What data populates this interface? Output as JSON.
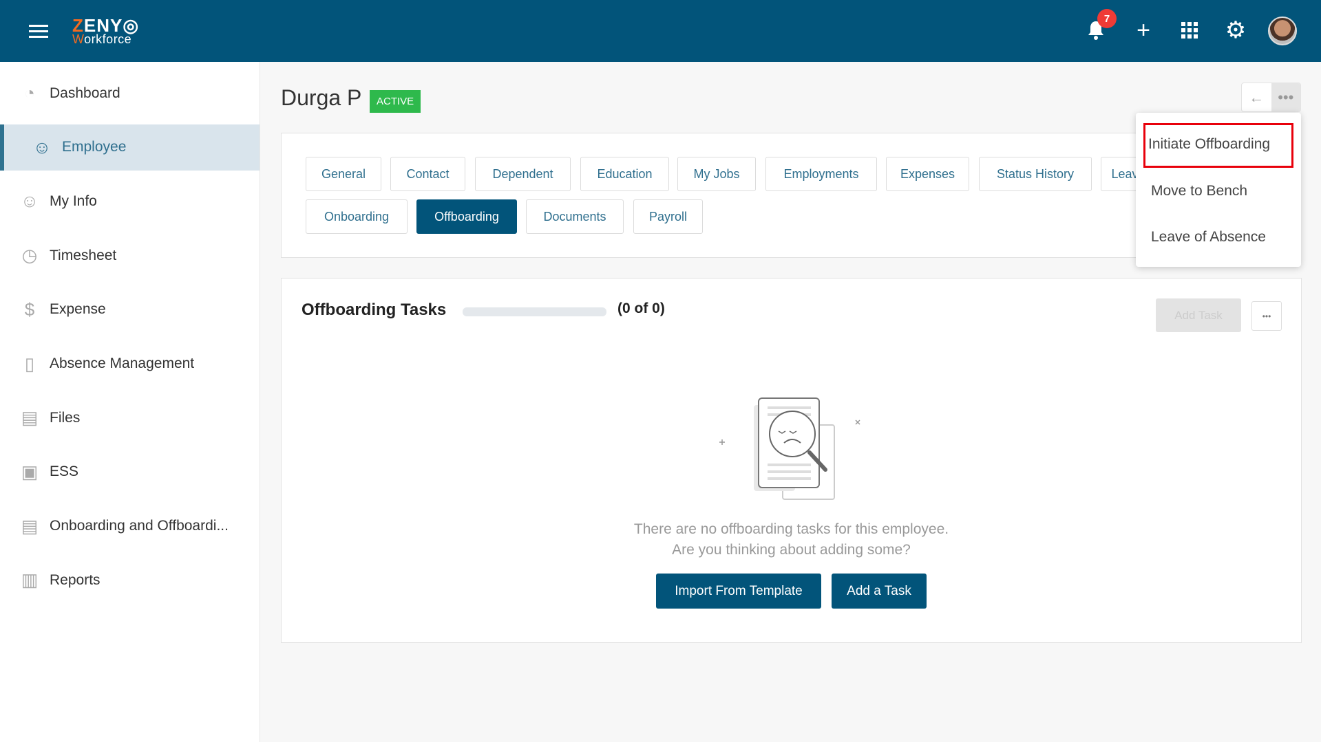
{
  "header": {
    "logo_line1_accent": "Z",
    "logo_line1": "ENY",
    "logo_line2_accent": "W",
    "logo_line2": "orkforce",
    "notification_count": "7",
    "brand_color": "#02547a"
  },
  "sidebar": {
    "items": [
      {
        "label": "Dashboard",
        "icon": "pie-chart-icon"
      },
      {
        "label": "Employee",
        "icon": "employee-icon",
        "active": true
      },
      {
        "label": "My Info",
        "icon": "user-icon"
      },
      {
        "label": "Timesheet",
        "icon": "clock-icon"
      },
      {
        "label": "Expense",
        "icon": "money-icon"
      },
      {
        "label": "Absence Management",
        "icon": "door-icon"
      },
      {
        "label": "Files",
        "icon": "file-icon"
      },
      {
        "label": "ESS",
        "icon": "monitor-icon"
      },
      {
        "label": "Onboarding and Offboardi...",
        "icon": "id-card-icon"
      },
      {
        "label": "Reports",
        "icon": "report-icon"
      }
    ]
  },
  "employee": {
    "name": "Durga P",
    "status": "ACTIVE"
  },
  "tabs": [
    "General",
    "Contact",
    "Dependent",
    "Education",
    "My Jobs",
    "Employments",
    "Expenses",
    "Status History",
    "Leave",
    "Onboarding",
    "Offboarding",
    "Documents",
    "Payroll"
  ],
  "selected_tab": "Offboarding",
  "menu": {
    "items": [
      "Initiate Offboarding",
      "Move to Bench",
      "Leave of Absence"
    ],
    "highlighted": "Initiate Offboarding"
  },
  "tasks": {
    "title": "Offboarding Tasks",
    "progress_text": "(0 of 0)",
    "progress": 0,
    "add_task": "Add Task",
    "empty_line1": "There are no offboarding tasks for this employee.",
    "empty_line2": "Are you thinking about adding some?",
    "import_button": "Import From Template",
    "add_button": "Add a Task"
  }
}
